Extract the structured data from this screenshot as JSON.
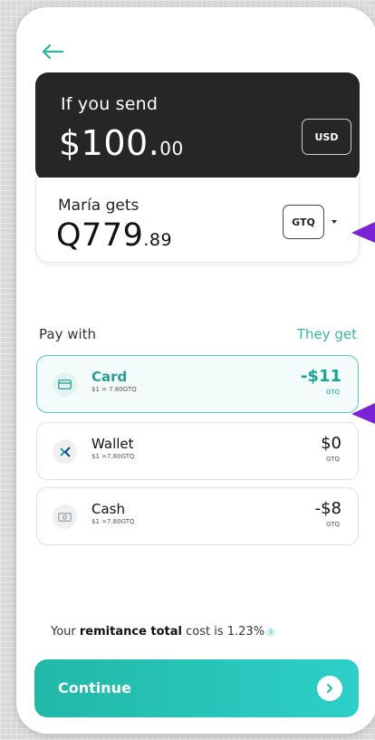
{
  "send": {
    "label": "If you send",
    "amount_main": "$100.",
    "amount_cents": "00",
    "currency": "USD"
  },
  "receive": {
    "label": "María gets",
    "amount_main": "Q779",
    "amount_cents": ".89",
    "currency": "GTQ"
  },
  "payment": {
    "pay_with_label": "Pay with",
    "they_get_label": "They get",
    "methods": [
      {
        "name": "Card",
        "rate": "$1 = 7.80GTQ",
        "fee": "-$11",
        "fee_currency": "GTQ",
        "selected": true,
        "icon": "card-icon"
      },
      {
        "name": "Wallet",
        "rate": "$1 =7.80GTQ",
        "fee": "$0",
        "fee_currency": "GTQ",
        "selected": false,
        "icon": "wallet-icon"
      },
      {
        "name": "Cash",
        "rate": "$1 =7.80GTQ",
        "fee": "-$8",
        "fee_currency": "GTQ",
        "selected": false,
        "icon": "cash-icon"
      }
    ]
  },
  "total": {
    "prefix": "Your ",
    "bold": "remitance total",
    "suffix": " cost is 1.23%",
    "info_icon": "i"
  },
  "continue_label": "Continue",
  "colors": {
    "accent": "#2ebfb1",
    "dark_card": "#262628",
    "pointer": "#7a22d6"
  }
}
